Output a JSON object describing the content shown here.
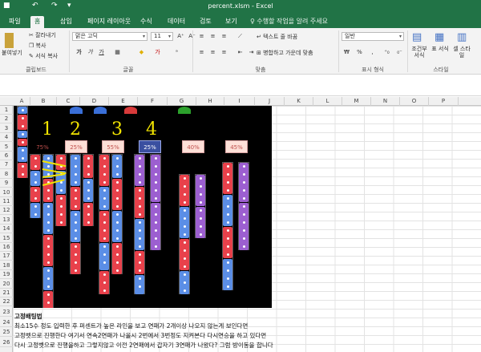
{
  "title": "percent.xlsm - Excel",
  "tabs": [
    "파일",
    "홈",
    "삽입",
    "페이지 레이아웃",
    "수식",
    "데이터",
    "검토",
    "보기"
  ],
  "tell_me": "수행할 작업을 알려 주세요",
  "clipboard": {
    "cut": "잘라내기",
    "copy": "복사",
    "format": "서식 복사",
    "paste": "붙여넣기",
    "group": "클립보드"
  },
  "font": {
    "name": "맑은 고딕",
    "size": "11",
    "group": "글꼴"
  },
  "align": {
    "wrap": "텍스트 줄 바꿈",
    "merge": "병합하고 가운데 맞춤",
    "group": "맞춤"
  },
  "number": {
    "format": "일반",
    "group": "표시 형식"
  },
  "styles": {
    "cond": "조건부 서식",
    "table": "표 서식",
    "cell": "셀 스타일",
    "group": "스타일"
  },
  "columns": [
    "A",
    "B",
    "C",
    "D",
    "E",
    "F",
    "G",
    "H",
    "I",
    "J",
    "K",
    "L",
    "M",
    "N",
    "O",
    "P"
  ],
  "rows": [
    "1",
    "2",
    "3",
    "4",
    "5",
    "6",
    "7",
    "8",
    "9",
    "10",
    "11",
    "12",
    "13",
    "14",
    "15",
    "16",
    "17",
    "18",
    "19",
    "20",
    "21",
    "22",
    "23",
    "24",
    "25",
    "26"
  ],
  "board": {
    "numbers": [
      "1",
      "2",
      "3",
      "4"
    ],
    "percents": [
      "75%",
      "25%",
      "55%",
      "25%",
      "40%",
      "45%"
    ]
  },
  "notes": {
    "heading": "고정배팅법",
    "lines": [
      "최소15수 정도 입력한 후 퍼센트가 높은 라인을 보고 연패가 2개이상 나오지 않는게 보인다면",
      "고정벳으로 진행한다 여기서 연속2연패가 나올시 2번에서 3번정도 지켜본다 다시연승을 하고 있다면",
      "다시 고정벳으로 진행을하고 그렇지않고 이전 2연패에서 갑자기 3연패가 나왔다? 그럼 방이동을 합니다"
    ]
  }
}
